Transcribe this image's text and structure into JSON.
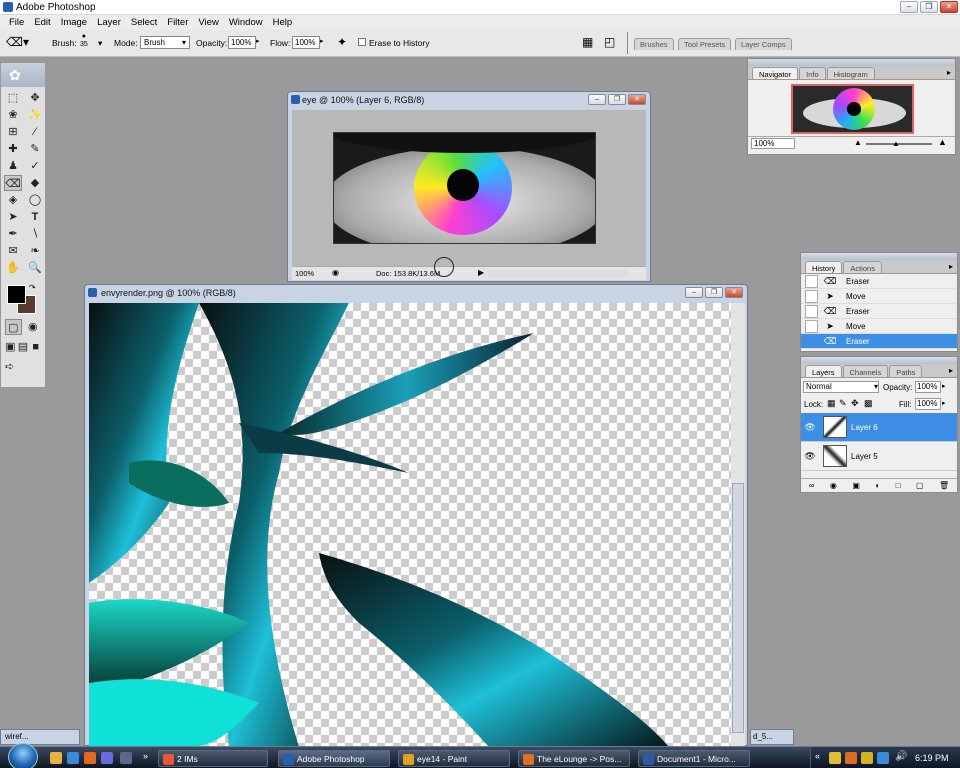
{
  "app": {
    "title": "Adobe Photoshop"
  },
  "menu": [
    "File",
    "Edit",
    "Image",
    "Layer",
    "Select",
    "Filter",
    "View",
    "Window",
    "Help"
  ],
  "options": {
    "brush_label": "Brush:",
    "brush_size": "35",
    "mode_label": "Mode:",
    "mode_value": "Brush",
    "opacity_label": "Opacity:",
    "opacity_value": "100%",
    "flow_label": "Flow:",
    "flow_value": "100%",
    "erase_history_label": "Erase to History"
  },
  "palette_well": [
    "Brushes",
    "Tool Presets",
    "Layer Comps"
  ],
  "doc_eye": {
    "title": "eye @ 100% (Layer 6, RGB/8)",
    "zoom": "100%",
    "doc_info": "Doc: 153.8K/13.6M"
  },
  "doc_envy": {
    "title": "envyrender.png @ 100% (RGB/8)"
  },
  "navigator": {
    "tabs": [
      "Navigator",
      "Info",
      "Histogram"
    ],
    "zoom": "100%"
  },
  "history": {
    "tabs": [
      "History",
      "Actions"
    ],
    "items": [
      {
        "label": "Eraser",
        "icon": "eraser-icon"
      },
      {
        "label": "Move",
        "icon": "move-icon"
      },
      {
        "label": "Eraser",
        "icon": "eraser-icon"
      },
      {
        "label": "Move",
        "icon": "move-icon"
      },
      {
        "label": "Eraser",
        "icon": "eraser-icon",
        "selected": true
      }
    ]
  },
  "layers": {
    "tabs": [
      "Layers",
      "Channels",
      "Paths"
    ],
    "blend_mode": "Normal",
    "opacity_label": "Opacity:",
    "opacity_value": "100%",
    "lock_label": "Lock:",
    "fill_label": "Fill:",
    "fill_value": "100%",
    "items": [
      {
        "name": "Layer 6",
        "selected": true
      },
      {
        "name": "Layer 5",
        "selected": false
      }
    ]
  },
  "minimized": {
    "left": "wiref...",
    "right": "d_5..."
  },
  "taskbar": {
    "buttons": [
      {
        "label": "2 IMs",
        "color": "#e8583a"
      },
      {
        "label": "Adobe Photoshop",
        "color": "#2b5fae"
      },
      {
        "label": "eye14 - Paint",
        "color": "#e0a020"
      },
      {
        "label": "The eLounge -> Pos...",
        "color": "#e07020"
      },
      {
        "label": "Document1 - Micro...",
        "color": "#2a5aa8"
      }
    ],
    "clock": "6:19 PM"
  },
  "colors": {
    "selection": "#3d8fe6",
    "title_bg": "#c8d4e4",
    "accent": "#2b5fae"
  }
}
